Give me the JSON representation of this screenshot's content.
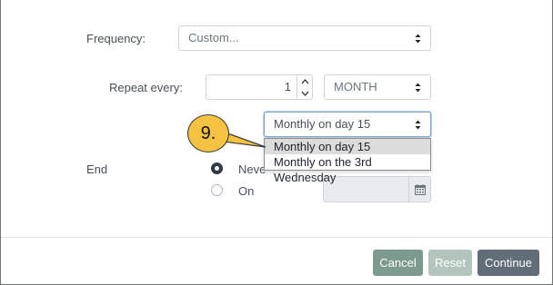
{
  "form": {
    "frequency": {
      "label": "Frequency:",
      "value": "Custom..."
    },
    "repeat_every": {
      "label": "Repeat every:",
      "number": "1",
      "unit": "MONTH"
    },
    "monthly_select": {
      "value": "Monthly on day 15",
      "options": [
        "Monthly on day 15",
        "Monthly on the 3rd Wednesday"
      ]
    },
    "end": {
      "label": "End",
      "never_label": "Neve",
      "on_label": "On"
    }
  },
  "callout": {
    "text": "9."
  },
  "footer": {
    "cancel": "Cancel",
    "reset": "Reset",
    "continue": "Continue"
  },
  "colors": {
    "cancel": "#7d9a8e",
    "reset": "#b4c5be",
    "continue": "#636d78",
    "callout": "#f5c242"
  }
}
